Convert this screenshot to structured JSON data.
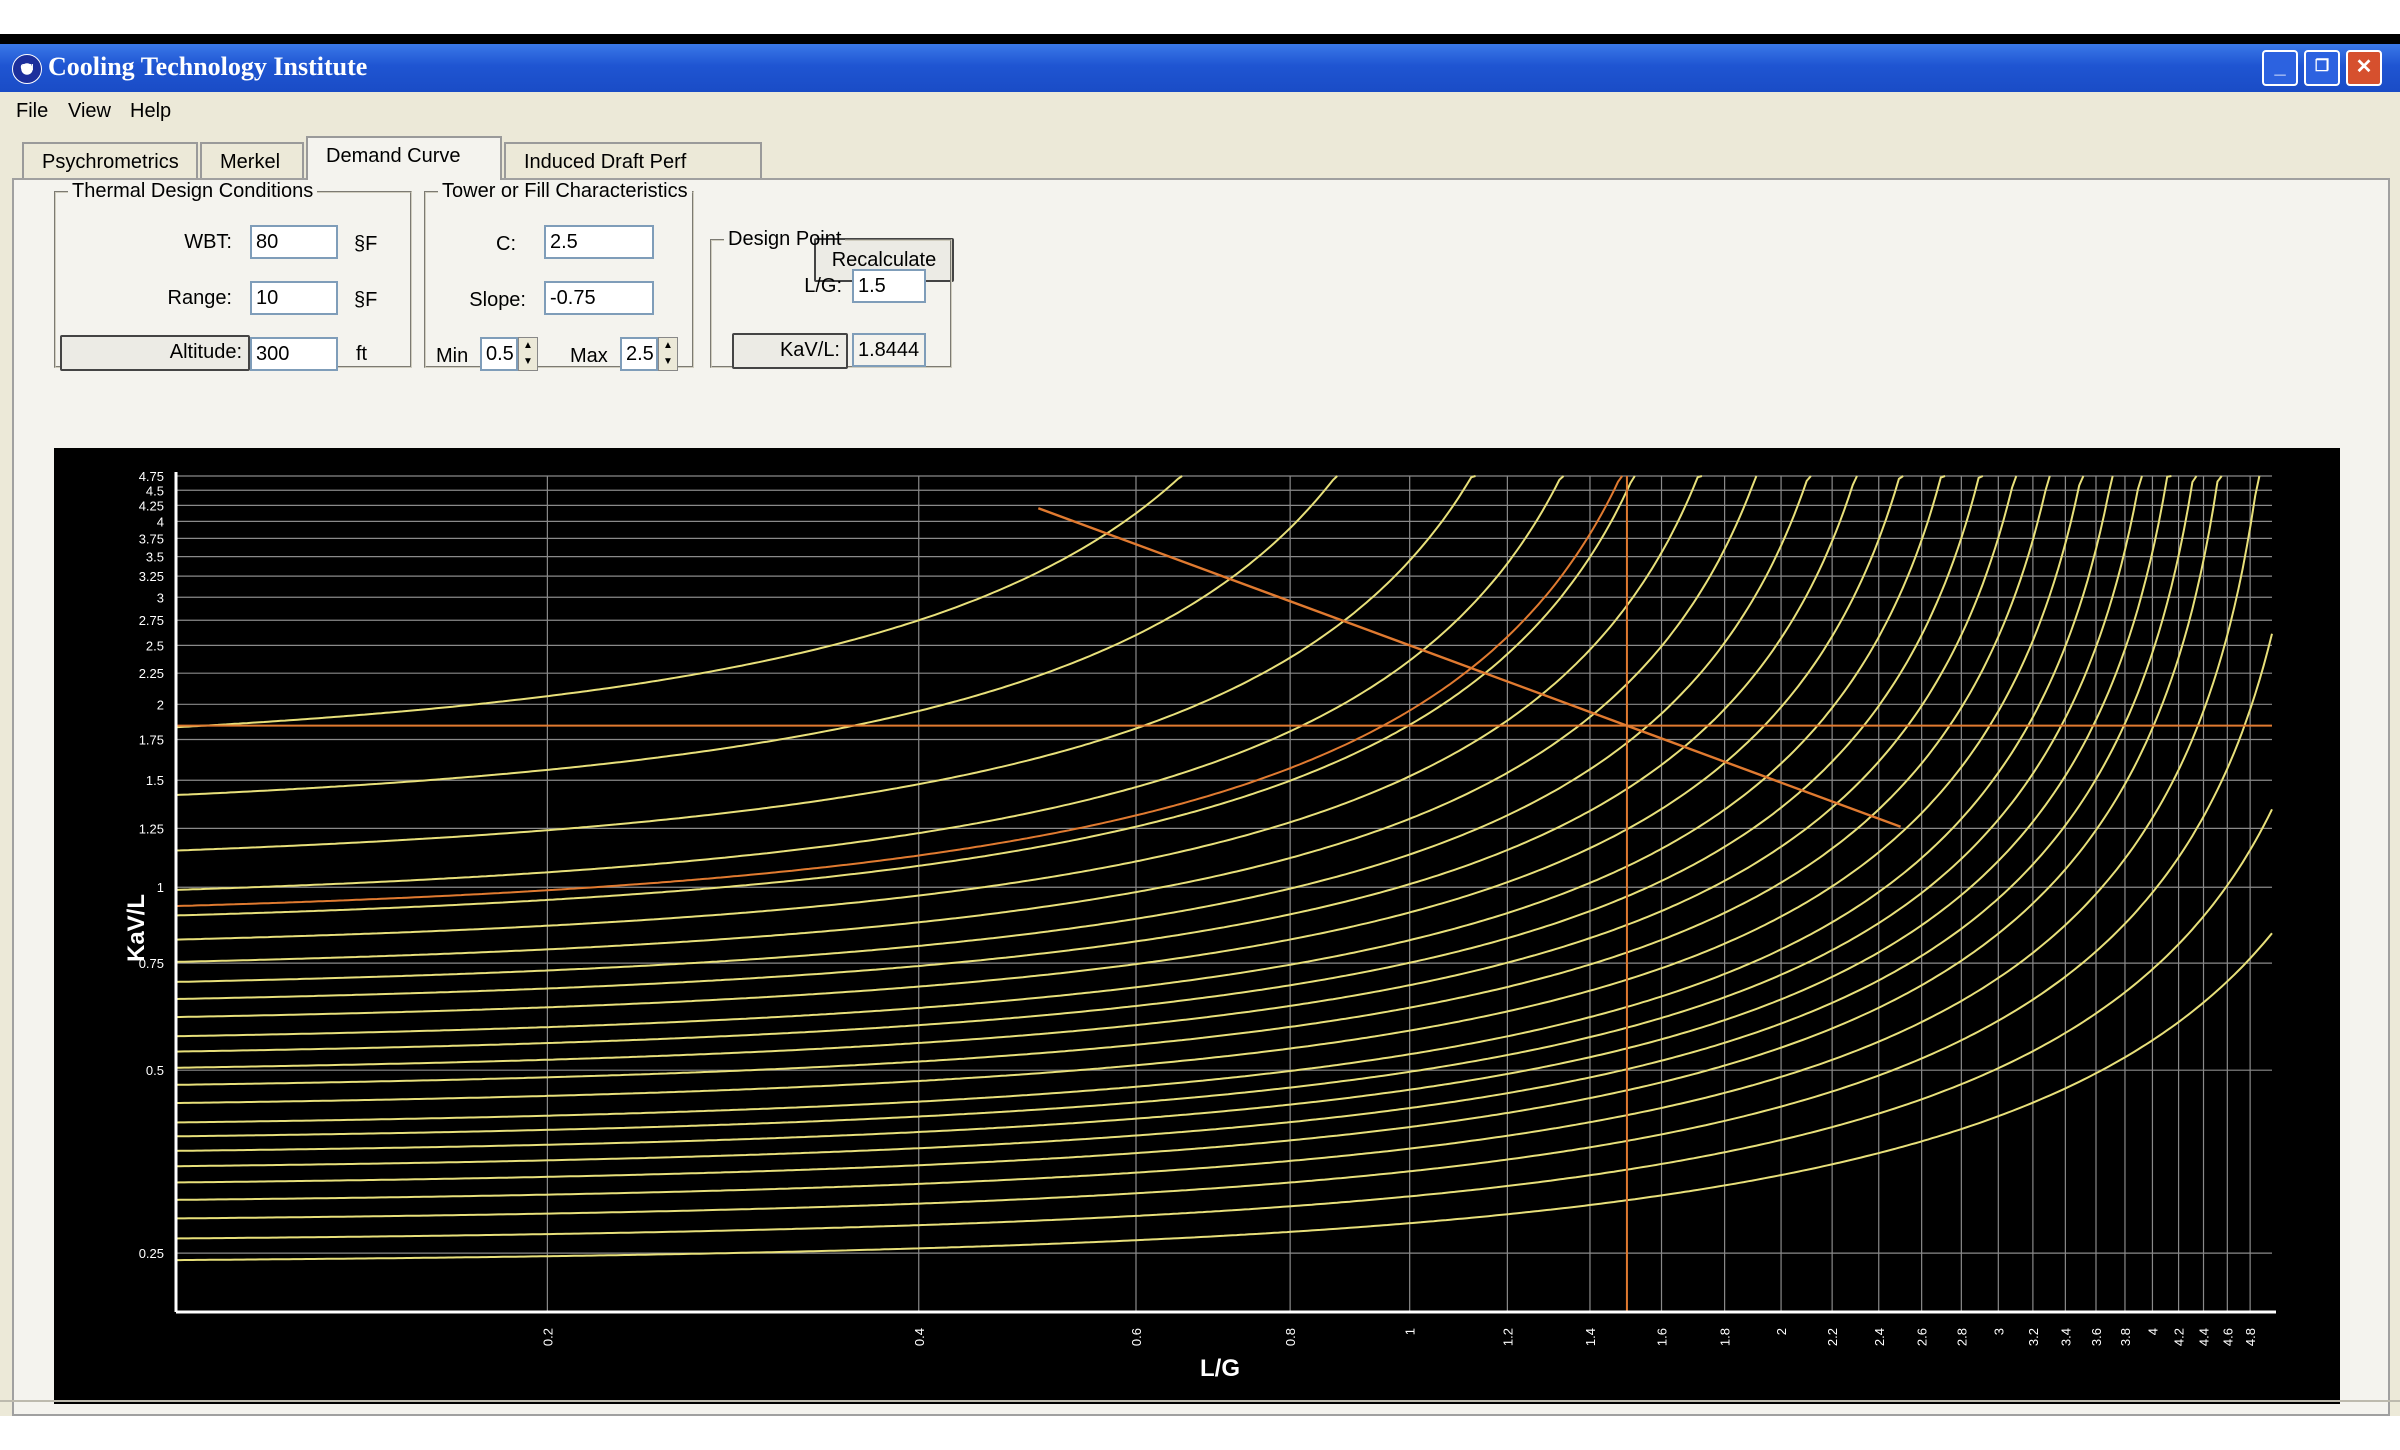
{
  "window": {
    "title": "Cooling Technology Institute",
    "logo_text": "CTI"
  },
  "menu": [
    "File",
    "View",
    "Help"
  ],
  "tabs": [
    {
      "label": "Psychrometrics"
    },
    {
      "label": "Merkel"
    },
    {
      "label": "Demand Curve"
    },
    {
      "label": "Induced Draft Perf Curve"
    }
  ],
  "thermal": {
    "legend": "Thermal Design Conditions",
    "wbt_label": "WBT:",
    "wbt_value": "80",
    "wbt_unit": "§F",
    "range_label": "Range:",
    "range_value": "10",
    "range_unit": "§F",
    "altitude_label": "Altitude:",
    "altitude_value": "300",
    "altitude_unit": "ft"
  },
  "tower": {
    "legend": "Tower or Fill Characteristics",
    "c_label": "C:",
    "c_value": "2.5",
    "slope_label": "Slope:",
    "slope_value": "-0.75",
    "min_label": "Min",
    "min_value": "0.5",
    "max_label": "Max",
    "max_value": "2.5"
  },
  "recalculate_label": "Recalculate",
  "design": {
    "legend": "Design Point",
    "lg_label": "L/G:",
    "lg_value": "1.5",
    "kavl_label": "KaV/L:",
    "kavl_value": "1.8444"
  },
  "colors": {
    "curve": "#e8e07a",
    "characteristic": "#e07a30",
    "grid": "#8a8a8a",
    "bg": "#000000"
  },
  "chart_data": {
    "type": "line",
    "xlabel": "L/G",
    "ylabel": "KaV/L",
    "xscale": "log",
    "yscale": "log",
    "xlim": [
      0.1,
      5
    ],
    "ylim": [
      0.2,
      4.75
    ],
    "x_ticks": [
      "0.2",
      "0.4",
      "0.6",
      "0.8",
      "1",
      "1.2",
      "1.4",
      "1.6",
      "1.8",
      "2",
      "2.2",
      "2.4",
      "2.6",
      "2.8",
      "3",
      "3.2",
      "3.4",
      "3.6",
      "3.8",
      "4",
      "4.2",
      "4.4",
      "4.6",
      "4.8"
    ],
    "y_ticks": [
      "0.25",
      "0.5",
      "0.75",
      "1",
      "1.25",
      "1.5",
      "1.75",
      "2",
      "2.25",
      "2.5",
      "2.75",
      "3",
      "3.25",
      "3.5",
      "3.75",
      "4",
      "4.25",
      "4.5",
      "4.75"
    ],
    "demand_curves": [
      {
        "asymptote": 1.0,
        "k0": 1.65
      },
      {
        "asymptote": 1.2,
        "k0": 1.3
      },
      {
        "asymptote": 1.45,
        "k0": 1.07
      },
      {
        "asymptote": 1.65,
        "k0": 0.93
      },
      {
        "asymptote": 1.85,
        "k0": 0.85
      },
      {
        "asymptote": 2.05,
        "k0": 0.78
      },
      {
        "asymptote": 2.25,
        "k0": 0.72
      },
      {
        "asymptote": 2.45,
        "k0": 0.67
      },
      {
        "asymptote": 2.65,
        "k0": 0.63
      },
      {
        "asymptote": 2.85,
        "k0": 0.59
      },
      {
        "asymptote": 3.05,
        "k0": 0.55
      },
      {
        "asymptote": 3.25,
        "k0": 0.52
      },
      {
        "asymptote": 3.45,
        "k0": 0.49
      },
      {
        "asymptote": 3.65,
        "k0": 0.46
      },
      {
        "asymptote": 3.85,
        "k0": 0.43
      },
      {
        "asymptote": 4.05,
        "k0": 0.4
      },
      {
        "asymptote": 4.25,
        "k0": 0.38
      },
      {
        "asymptote": 4.45,
        "k0": 0.36
      },
      {
        "asymptote": 4.65,
        "k0": 0.34
      },
      {
        "asymptote": 4.85,
        "k0": 0.32
      },
      {
        "asymptote": 5.2,
        "k0": 0.3
      },
      {
        "asymptote": 5.6,
        "k0": 0.28
      },
      {
        "asymptote": 6.2,
        "k0": 0.26
      },
      {
        "asymptote": 7.0,
        "k0": 0.24
      }
    ],
    "design_curve": {
      "asymptote": 1.82,
      "k0": 0.88
    },
    "characteristic_line": {
      "c": 2.5,
      "slope": -0.75,
      "lg_min": 0.5,
      "lg_max": 2.5
    },
    "design_point": {
      "lg": 1.5,
      "kavl": 1.8444
    }
  }
}
